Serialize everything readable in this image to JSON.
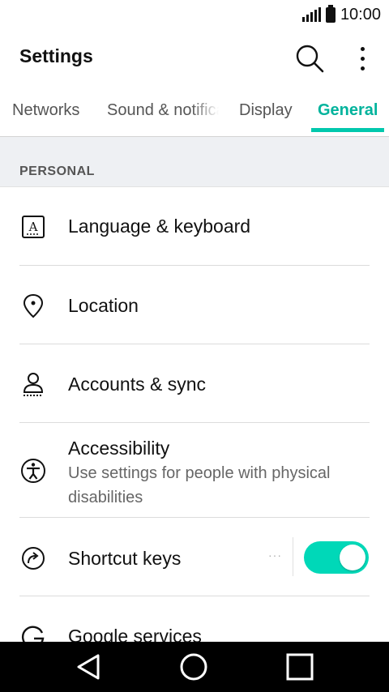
{
  "status_bar": {
    "time": "10:00",
    "signal_icon": "signal-icon",
    "battery_icon": "battery-icon"
  },
  "header": {
    "title": "Settings",
    "search_icon": "search-icon",
    "more_icon": "more-vert-icon"
  },
  "tabs": [
    {
      "label": "Networks",
      "active": false
    },
    {
      "label": "Sound & notifications",
      "active": false
    },
    {
      "label": "Display",
      "active": false
    },
    {
      "label": "General",
      "active": true
    }
  ],
  "section": {
    "label": "PERSONAL"
  },
  "items": [
    {
      "title": "Language & keyboard",
      "icon": "language-keyboard-icon"
    },
    {
      "title": "Location",
      "icon": "location-pin-icon"
    },
    {
      "title": "Accounts & sync",
      "icon": "accounts-icon"
    },
    {
      "title": "Accessibility",
      "subtitle": "Use settings for people with physical disabilities",
      "icon": "accessibility-icon"
    },
    {
      "title": "Shortcut keys",
      "icon": "shortcut-icon",
      "toggle_on": true,
      "menu_dots": "···"
    },
    {
      "title": "Google services",
      "icon": "google-icon"
    }
  ],
  "colors": {
    "accent": "#00B39C",
    "toggle": "#00D8B8",
    "section_bg": "#EEF0F3",
    "nav_bg": "#000000"
  },
  "nav": {
    "back_icon": "back-icon",
    "home_icon": "home-icon",
    "recents_icon": "recents-icon"
  }
}
